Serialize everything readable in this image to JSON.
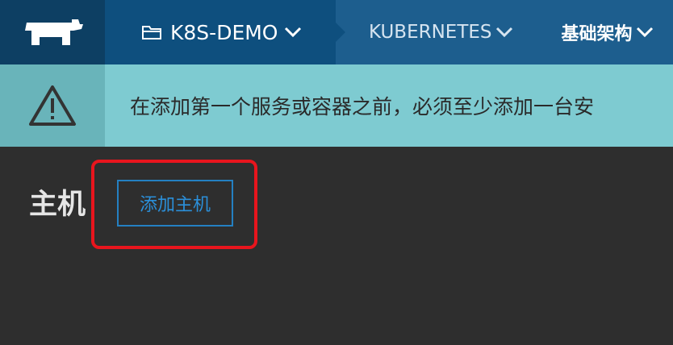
{
  "header": {
    "logo_icon": "rancher-logo-icon",
    "environment": {
      "icon": "folder-icon",
      "label": "K8S-DEMO"
    },
    "nav": [
      {
        "label": "KUBERNETES"
      },
      {
        "label": "基础架构"
      }
    ]
  },
  "alert": {
    "icon": "warning-triangle-icon",
    "message": "在添加第一个服务或容器之前，必须至少添加一台安"
  },
  "main": {
    "title": "主机",
    "add_host_label": "添加主机"
  },
  "colors": {
    "header_bg": "#1d5e8e",
    "logo_bg": "#0d3f63",
    "env_bg": "#0e4f7e",
    "alert_bg": "#7ecbd1",
    "alert_icon_bg": "#69b4ba",
    "page_bg": "#2e2e2e",
    "button_accent": "#2b8fd9",
    "highlight": "#e8151d"
  }
}
